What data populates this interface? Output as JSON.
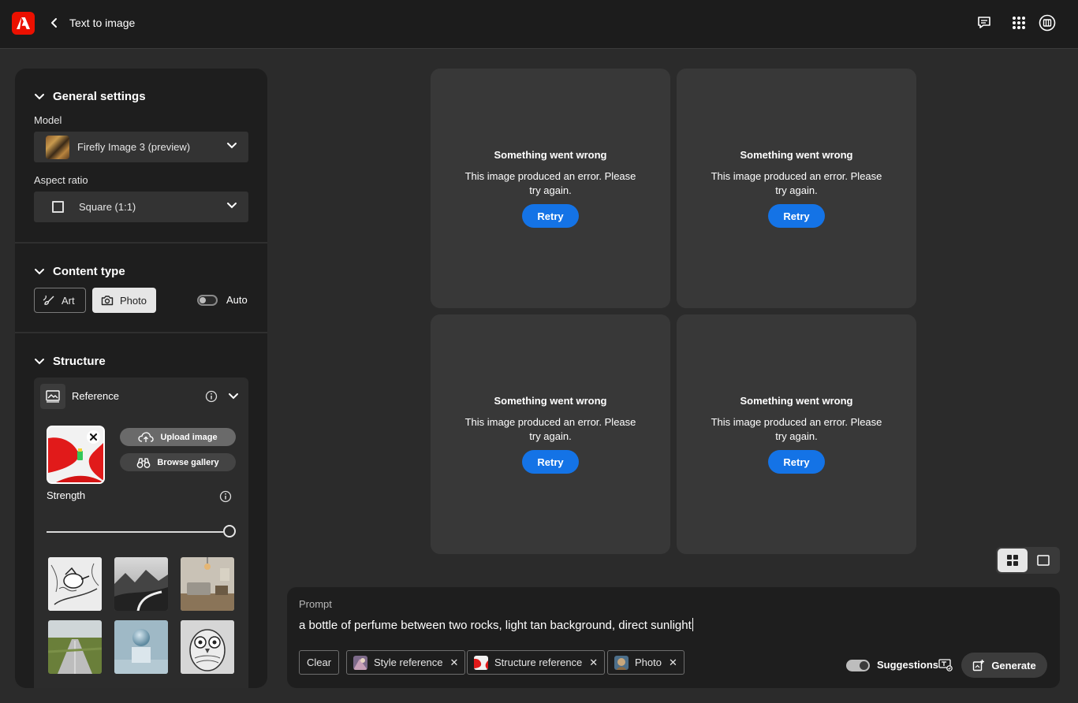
{
  "header": {
    "title": "Text to image"
  },
  "sidebar": {
    "general": {
      "heading": "General settings",
      "model_label": "Model",
      "model_value": "Firefly Image 3 (preview)",
      "aspect_label": "Aspect ratio",
      "aspect_value": "Square (1:1)"
    },
    "content_type": {
      "heading": "Content type",
      "art_label": "Art",
      "photo_label": "Photo",
      "selected": "Photo",
      "auto_label": "Auto",
      "auto_on": false
    },
    "structure": {
      "heading": "Structure",
      "reference_label": "Reference",
      "upload_label": "Upload image",
      "browse_label": "Browse gallery",
      "strength_label": "Strength",
      "strength_value": 1.0
    }
  },
  "cards": [
    {
      "title": "Something went wrong",
      "message": "This image produced an error. Please try again.",
      "button": "Retry"
    },
    {
      "title": "Something went wrong",
      "message": "This image produced an error. Please try again.",
      "button": "Retry"
    },
    {
      "title": "Something went wrong",
      "message": "This image produced an error. Please try again.",
      "button": "Retry"
    },
    {
      "title": "Something went wrong",
      "message": "This image produced an error. Please try again.",
      "button": "Retry"
    }
  ],
  "prompt": {
    "label": "Prompt",
    "text": "a bottle of perfume between two rocks, light tan background, direct sunlight",
    "clear_label": "Clear",
    "chips": [
      "Style reference",
      "Structure reference",
      "Photo"
    ],
    "suggestions_label": "Suggestions",
    "suggestions_on": true,
    "generate_label": "Generate"
  },
  "colors": {
    "accent_blue": "#1473e6",
    "brand_red": "#eb1000",
    "panel": "#1e1e1e",
    "background": "#2b2b2b"
  }
}
